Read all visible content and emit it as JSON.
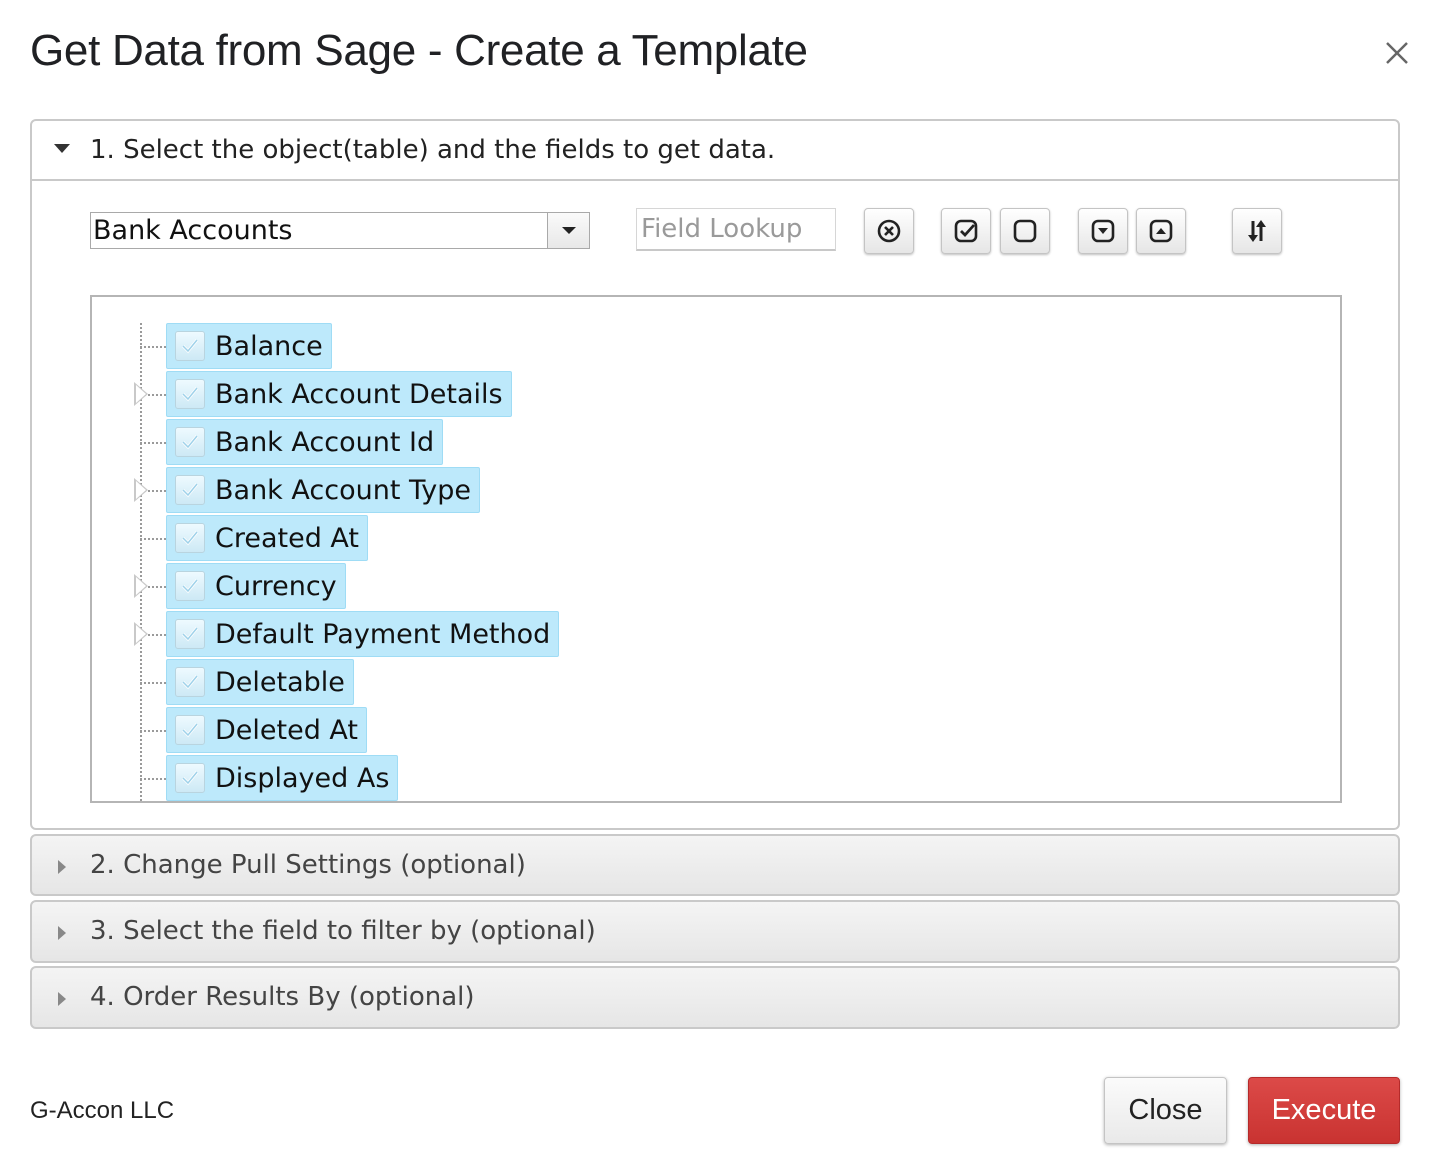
{
  "dialog": {
    "title": "Get Data from Sage - Create a Template",
    "close_icon": "close-x-icon"
  },
  "section1": {
    "label": "1. Select the object(table) and the fields to get data.",
    "expanded": true,
    "object_select": {
      "value": "Bank Accounts"
    },
    "field_lookup": {
      "value": "",
      "placeholder": "Field Lookup"
    },
    "toolbar": [
      {
        "name": "clear-icon",
        "action": "clear"
      },
      {
        "name": "check-all-icon",
        "action": "select-all"
      },
      {
        "name": "uncheck-all-icon",
        "action": "deselect-all"
      },
      {
        "name": "expand-all-icon",
        "action": "expand-all"
      },
      {
        "name": "collapse-all-icon",
        "action": "collapse-all"
      },
      {
        "name": "sort-icon",
        "action": "sort"
      }
    ],
    "fields": [
      {
        "label": "Balance",
        "checked": true,
        "expandable": false
      },
      {
        "label": "Bank Account Details",
        "checked": true,
        "expandable": true
      },
      {
        "label": "Bank Account Id",
        "checked": true,
        "expandable": false
      },
      {
        "label": "Bank Account Type",
        "checked": true,
        "expandable": true
      },
      {
        "label": "Created At",
        "checked": true,
        "expandable": false
      },
      {
        "label": "Currency",
        "checked": true,
        "expandable": true
      },
      {
        "label": "Default Payment Method",
        "checked": true,
        "expandable": true
      },
      {
        "label": "Deletable",
        "checked": true,
        "expandable": false
      },
      {
        "label": "Deleted At",
        "checked": true,
        "expandable": false
      },
      {
        "label": "Displayed As",
        "checked": true,
        "expandable": false
      }
    ]
  },
  "section2": {
    "label": "2. Change Pull Settings (optional)",
    "expanded": false
  },
  "section3": {
    "label": "3. Select the field to filter by (optional)",
    "expanded": false
  },
  "section4": {
    "label": "4. Order Results By (optional)",
    "expanded": false
  },
  "footer": {
    "company": "G-Accon LLC",
    "close_label": "Close",
    "execute_label": "Execute",
    "execute_color": "#d23f3d"
  }
}
